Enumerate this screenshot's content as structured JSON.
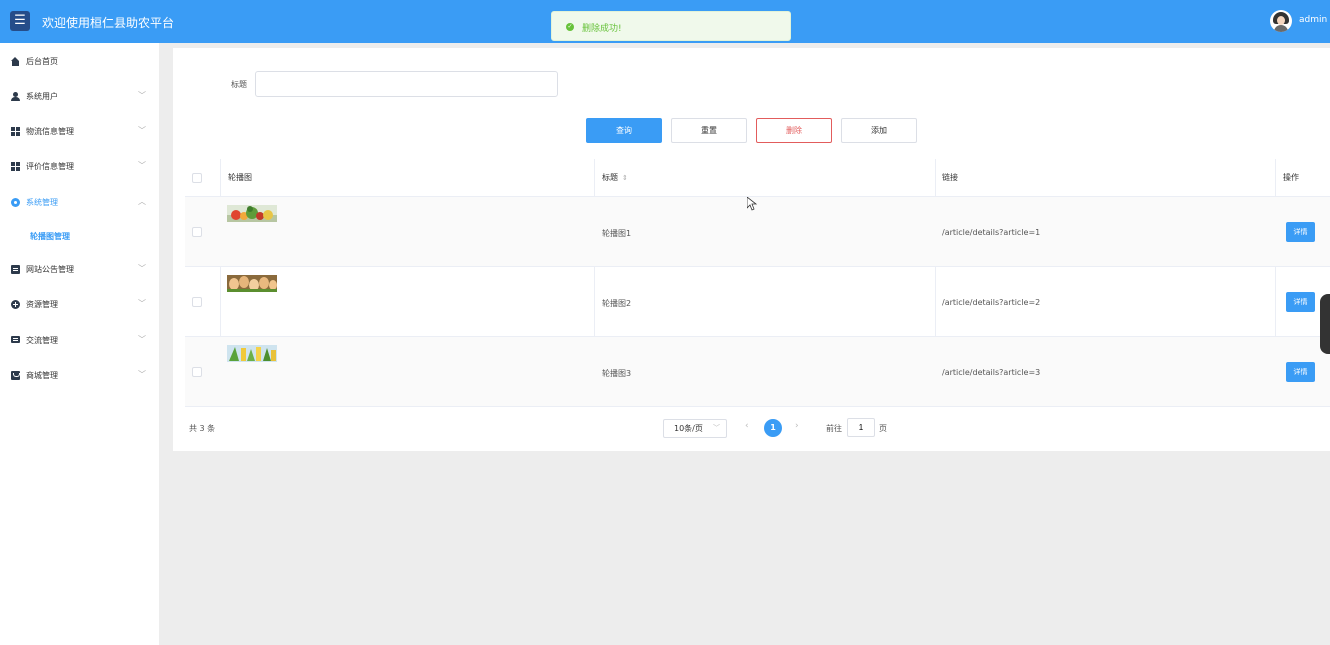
{
  "header": {
    "menu_icon": "☰",
    "title": "欢迎使用桓仁县助农平台",
    "username": "admin"
  },
  "toast": {
    "icon": "✓",
    "message": "删除成功!"
  },
  "sidebar": {
    "items": [
      {
        "label": "后台首页",
        "icon": "home-icon",
        "arrow": ""
      },
      {
        "label": "系统用户",
        "icon": "user-icon",
        "arrow": "﹀"
      },
      {
        "label": "物流信息管理",
        "icon": "grid-icon",
        "arrow": "﹀"
      },
      {
        "label": "评价信息管理",
        "icon": "grid-icon",
        "arrow": "﹀"
      },
      {
        "label": "系统管理",
        "icon": "gear-icon",
        "arrow": "︿"
      },
      {
        "label": "网站公告管理",
        "icon": "document-icon",
        "arrow": "﹀"
      },
      {
        "label": "资源管理",
        "icon": "plus-circle-icon",
        "arrow": "﹀"
      },
      {
        "label": "交流管理",
        "icon": "chat-icon",
        "arrow": "﹀"
      },
      {
        "label": "商城管理",
        "icon": "shop-icon",
        "arrow": "﹀"
      }
    ],
    "sub_item": "轮播图管理"
  },
  "filter": {
    "title_label": "标题",
    "title_value": ""
  },
  "toolbar": {
    "query": "查询",
    "reset": "重置",
    "delete": "删除",
    "add": "添加"
  },
  "table": {
    "headers": {
      "image": "轮播图",
      "title": "标题",
      "link": "链接",
      "action": "操作"
    },
    "sort_icon": "⇕",
    "detail_label": "详情",
    "rows": [
      {
        "title": "轮播图1",
        "link": "/article/details?article=1",
        "thumb": "vegetables"
      },
      {
        "title": "轮播图2",
        "link": "/article/details?article=2",
        "thumb": "eggs"
      },
      {
        "title": "轮播图3",
        "link": "/article/details?article=3",
        "thumb": "corn"
      }
    ]
  },
  "pagination": {
    "total": "共 3 条",
    "page_size": "10条/页",
    "prev": "‹",
    "current": "1",
    "next": "›",
    "goto_prefix": "前往",
    "goto_value": "1",
    "goto_suffix": "页"
  },
  "colors": {
    "primary": "#3a9cf5",
    "danger": "#e25c5c",
    "success": "#67c23a"
  }
}
